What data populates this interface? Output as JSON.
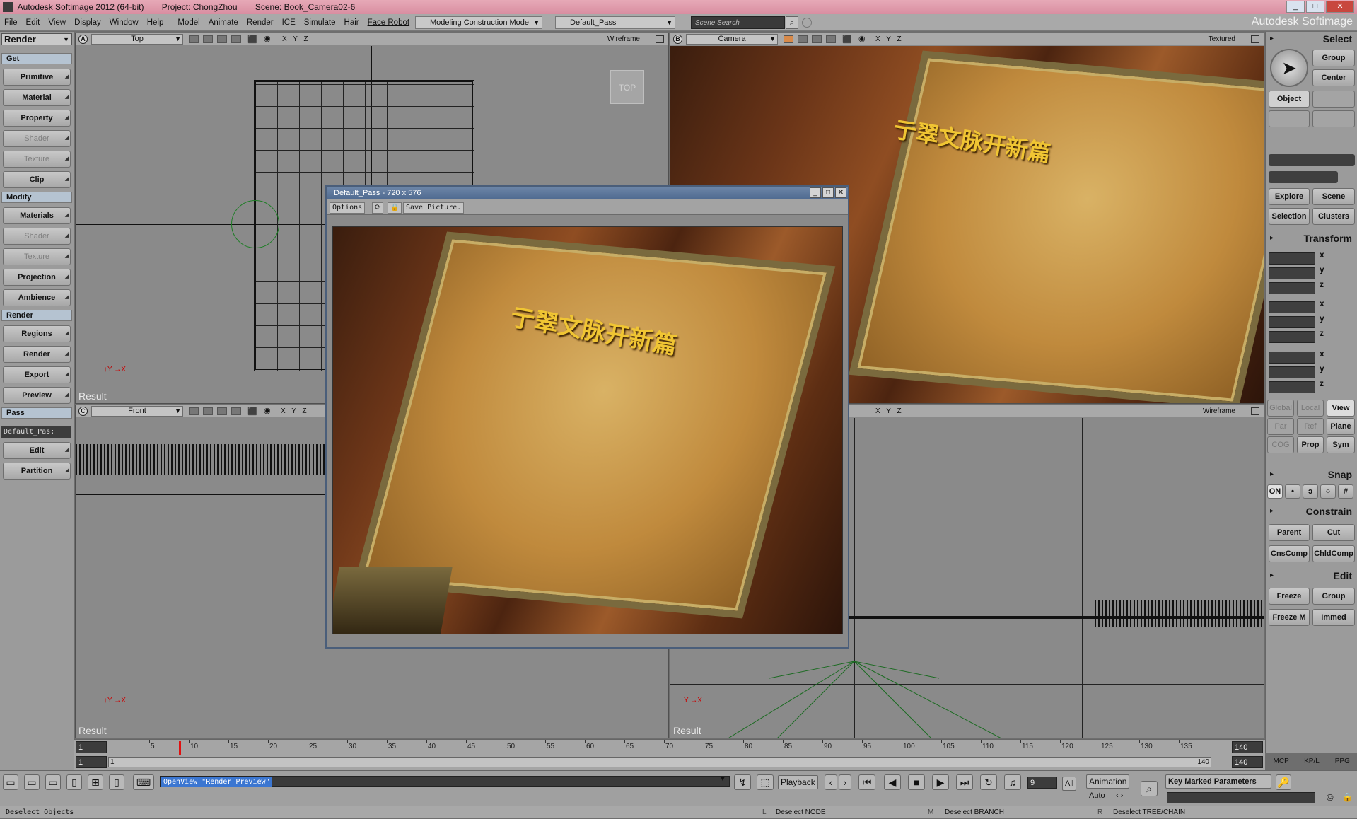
{
  "titlebar": {
    "app": "Autodesk Softimage 2012 (64-bit)",
    "project": "Project: ChongZhou",
    "scene": "Scene: Book_Camera02-6"
  },
  "menu": [
    "File",
    "Edit",
    "View",
    "Display",
    "Window",
    "Help",
    "Model",
    "Animate",
    "Render",
    "ICE",
    "Simulate",
    "Hair",
    "Face Robot"
  ],
  "toolbar": {
    "mode": "Modeling Construction Mode",
    "pass": "Default_Pass",
    "search_placeholder": "Scene Search",
    "brand": "Autodesk Softimage"
  },
  "left": {
    "module": "Render",
    "sections": {
      "get": "Get",
      "modify": "Modify",
      "render": "Render",
      "pass": "Pass"
    },
    "get_items": [
      {
        "label": "Primitive",
        "enabled": true
      },
      {
        "label": "Material",
        "enabled": true
      },
      {
        "label": "Property",
        "enabled": true
      },
      {
        "label": "Shader",
        "enabled": false
      },
      {
        "label": "Texture",
        "enabled": false
      },
      {
        "label": "Clip",
        "enabled": true
      }
    ],
    "modify_items": [
      {
        "label": "Materials",
        "enabled": true
      },
      {
        "label": "Shader",
        "enabled": false
      },
      {
        "label": "Texture",
        "enabled": false
      },
      {
        "label": "Projection",
        "enabled": true
      },
      {
        "label": "Ambience",
        "enabled": true
      }
    ],
    "render_items": [
      {
        "label": "Regions",
        "enabled": true
      },
      {
        "label": "Render",
        "enabled": true
      },
      {
        "label": "Export",
        "enabled": true
      },
      {
        "label": "Preview",
        "enabled": true
      }
    ],
    "pass_value": "Default_Pas:",
    "pass_items": [
      {
        "label": "Edit"
      },
      {
        "label": "Partition"
      }
    ]
  },
  "viewports": {
    "a": {
      "letter": "A",
      "camera": "Top",
      "mode": "Wireframe",
      "xyz": "X Y Z",
      "result": "Result",
      "nav": "TOP"
    },
    "b": {
      "letter": "B",
      "camera": "Camera",
      "mode": "Textured",
      "xyz": "X Y Z"
    },
    "c": {
      "letter": "C",
      "camera": "Front",
      "xyz": "X Y Z",
      "result": "Result"
    },
    "d": {
      "mode": "Wireframe",
      "xyz": "X Y Z",
      "result": "Result"
    }
  },
  "book_title": "亍翠文脉开新篇",
  "render_window": {
    "title": "Default_Pass - 720 x 576",
    "options": "Options",
    "save": "Save Picture."
  },
  "right": {
    "select_head": "Select",
    "group": "Group",
    "center": "Center",
    "object": "Object",
    "explore": "Explore",
    "scene": "Scene",
    "selection": "Selection",
    "clusters": "Clusters",
    "transform_head": "Transform",
    "axes": [
      "x",
      "y",
      "z"
    ],
    "global": "Global",
    "local": "Local",
    "view": "View",
    "par": "Par",
    "ref": "Ref",
    "plane": "Plane",
    "cog": "COG",
    "prop": "Prop",
    "sym": "Sym",
    "snap_head": "Snap",
    "on": "ON",
    "constrain_head": "Constrain",
    "parent": "Parent",
    "cut": "Cut",
    "cnscomp": "CnsComp",
    "chldcomp": "ChldComp",
    "edit_head": "Edit",
    "freeze": "Freeze",
    "group2": "Group",
    "freezem": "Freeze M",
    "immed": "Immed",
    "tabs": [
      "MCP",
      "KP/L",
      "PPG"
    ]
  },
  "timeline": {
    "start": "1",
    "end": "140",
    "end2": "140",
    "current": "9",
    "ticks": [
      "5",
      "10",
      "15",
      "20",
      "25",
      "30",
      "35",
      "40",
      "45",
      "50",
      "55",
      "60",
      "65",
      "70",
      "75",
      "80",
      "85",
      "90",
      "95",
      "100",
      "105",
      "110",
      "115",
      "120",
      "125",
      "130",
      "135"
    ],
    "range_start": "1",
    "range_end": "140"
  },
  "bottom": {
    "command": "OpenView \"Render Preview\"",
    "playback": "Playback",
    "frame": "9",
    "all": "All",
    "animation": "Animation",
    "auto": "Auto",
    "keymarked": "Key Marked Parameters"
  },
  "status": {
    "left": "Deselect Objects",
    "l": "L",
    "l_text": "Deselect NODE",
    "m": "M",
    "m_text": "Deselect BRANCH",
    "r": "R",
    "r_text": "Deselect TREE/CHAIN"
  }
}
